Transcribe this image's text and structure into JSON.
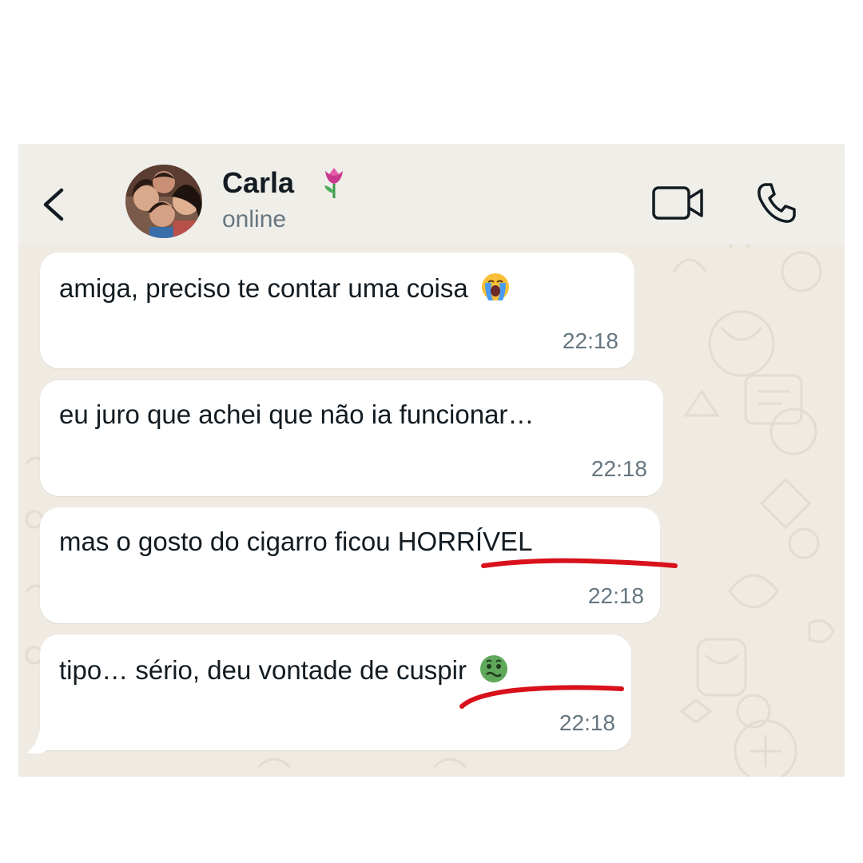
{
  "contact": {
    "name": "Carla",
    "name_emoji": "tulip-emoji",
    "status": "online"
  },
  "header_icons": [
    "chevron-left-icon",
    "video-call-icon",
    "phone-icon"
  ],
  "messages": [
    {
      "text": "amiga, preciso te contar uma coisa",
      "emoji": "loudly-crying-face-emoji",
      "time": "22:18"
    },
    {
      "text": "eu juro que achei que não ia funcionar…",
      "time": "22:18"
    },
    {
      "text": "mas o gosto do cigarro ficou HORRÍVEL",
      "time": "22:18"
    },
    {
      "text": "tipo… sério, deu vontade de cuspir",
      "emoji": "nauseated-face-emoji",
      "time": "22:18"
    }
  ],
  "colors": {
    "wallpaper": "#efeae2",
    "header_bg": "#f0eee9",
    "bubble": "#ffffff",
    "text": "#111b21",
    "secondary_text": "#667781",
    "annotation_red": "#d8111b"
  }
}
